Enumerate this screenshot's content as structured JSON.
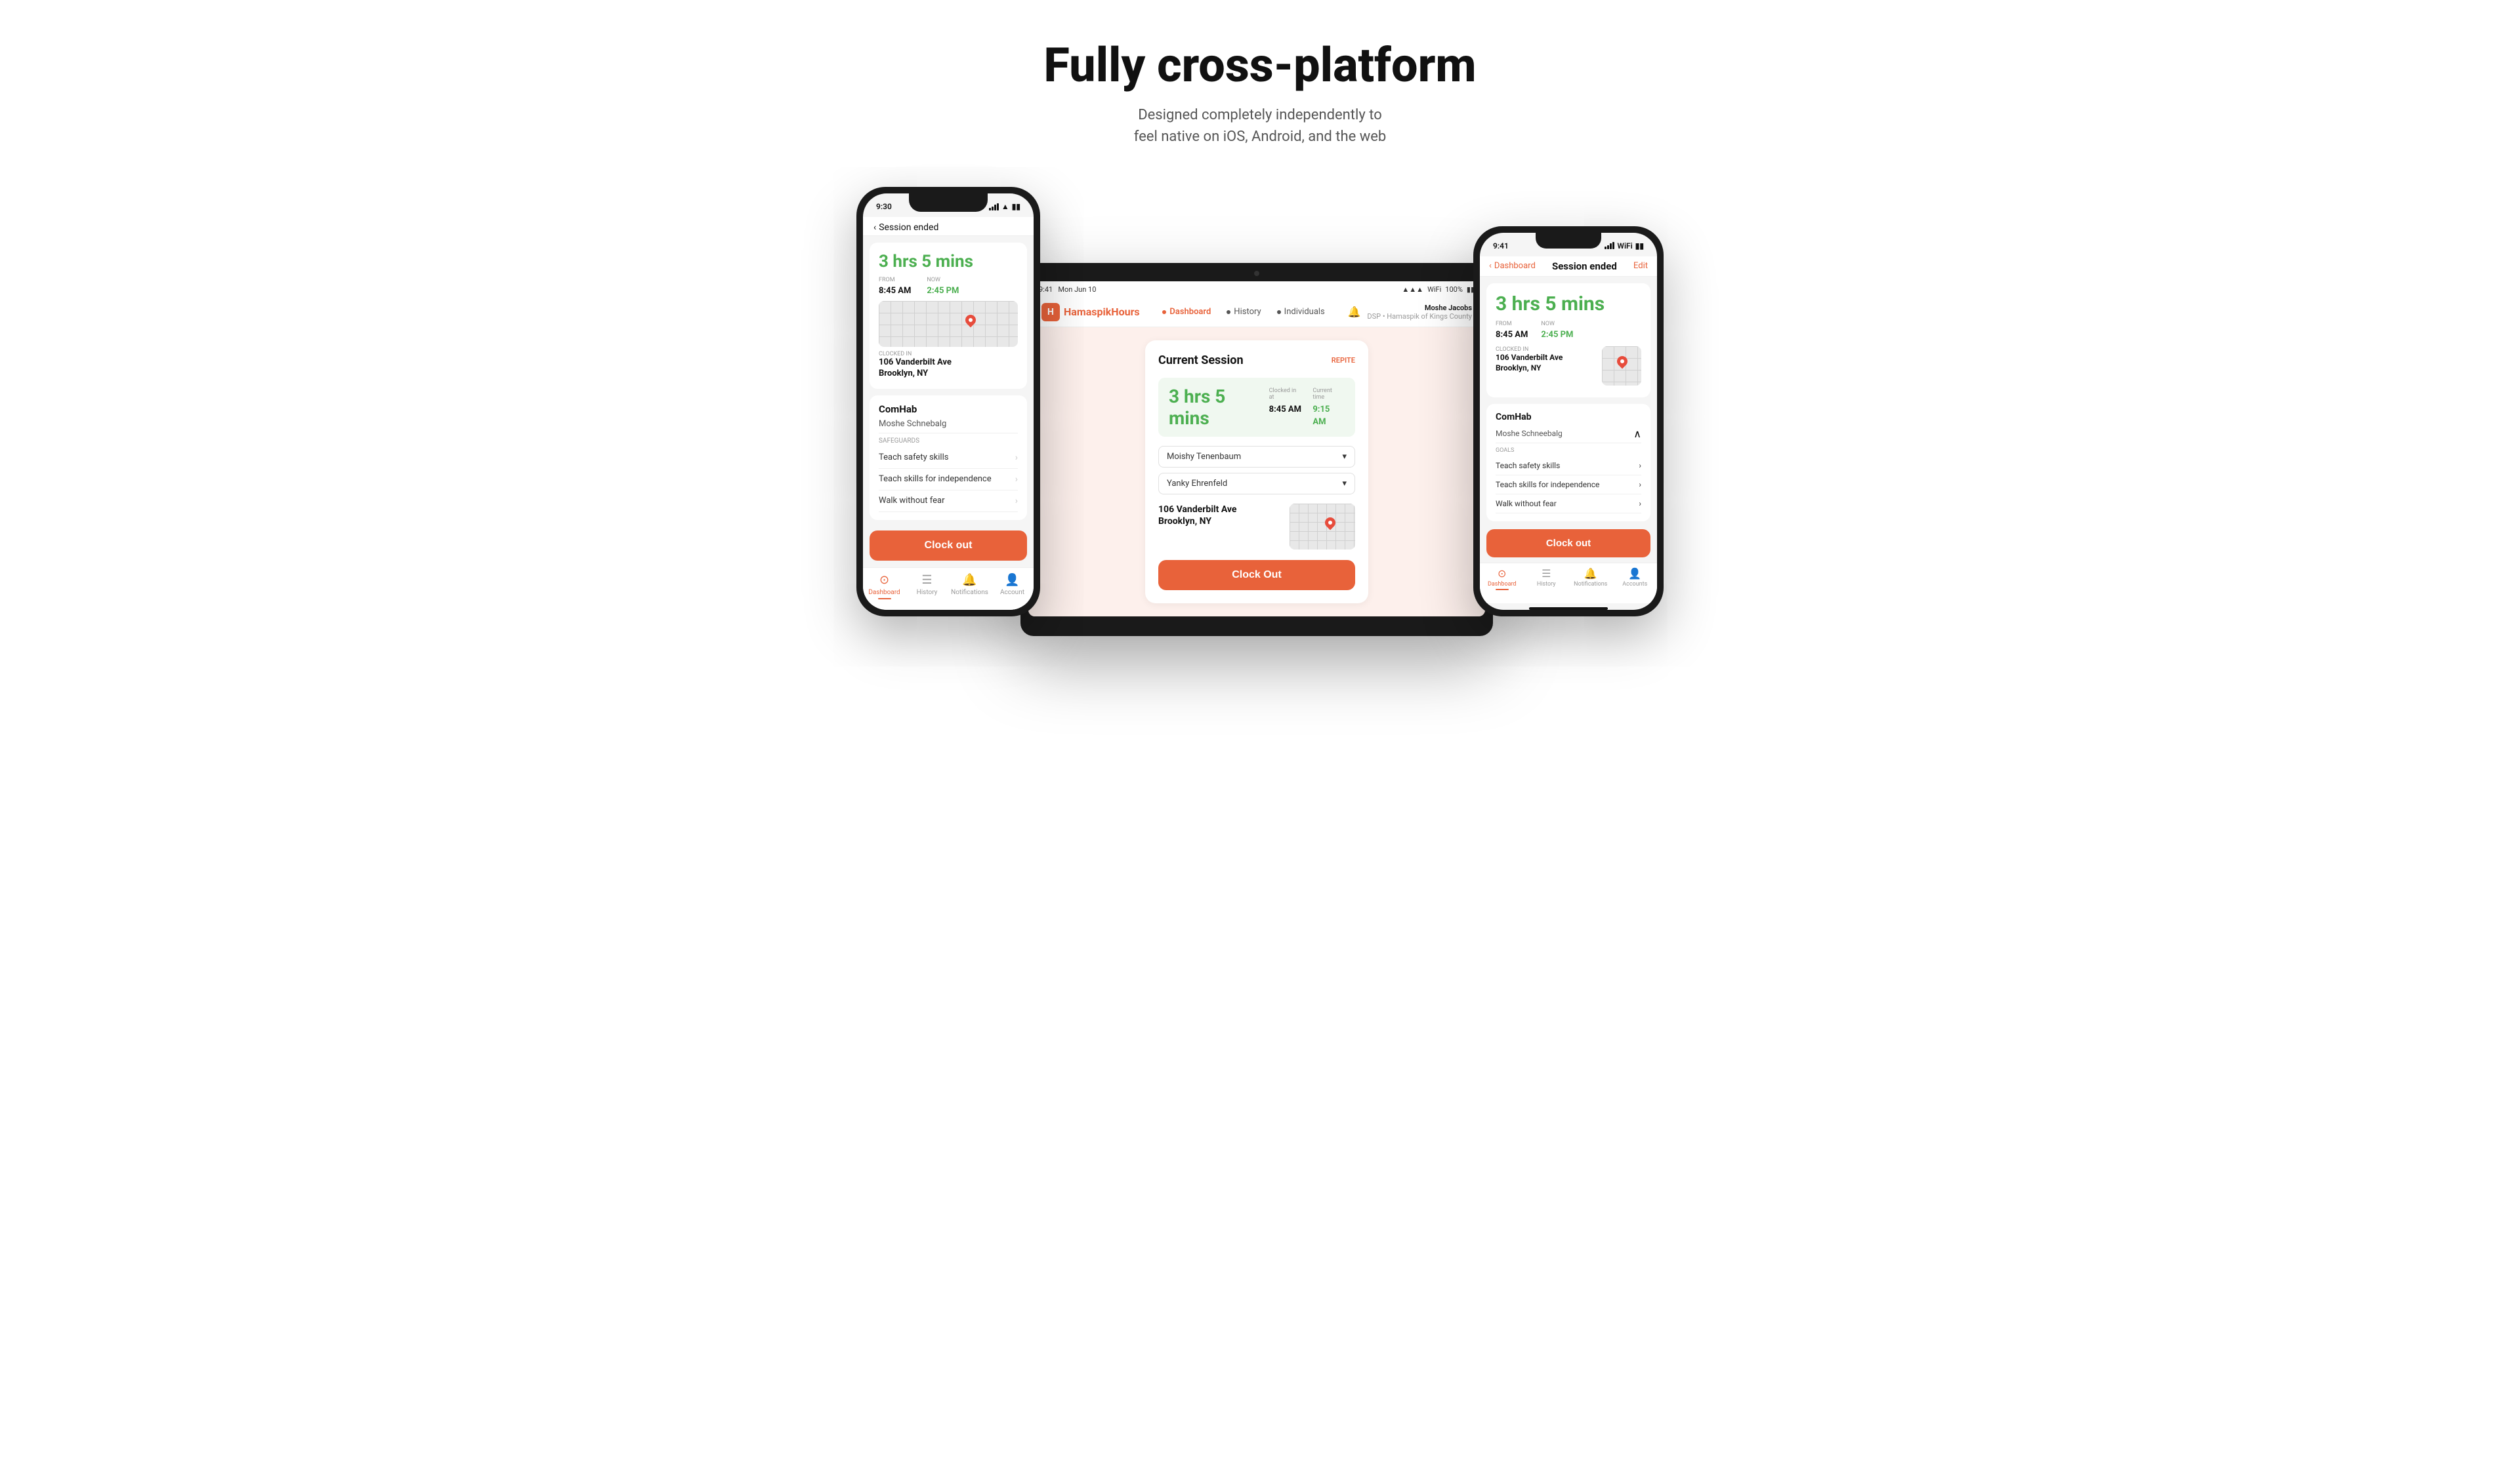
{
  "hero": {
    "title": "Fully cross-platform",
    "subtitle_line1": "Designed completely independently to",
    "subtitle_line2": "feel native on iOS, Android, and the web"
  },
  "left_phone": {
    "status_time": "9:30",
    "back_label": "Session ended",
    "session_duration": "3 hrs 5 mins",
    "from_label": "FROM",
    "now_label": "NOW",
    "from_time": "8:45 AM",
    "now_time": "2:45 PM",
    "clocked_in_label": "CLOCKED IN",
    "address_line1": "106 Vanderbilt Ave",
    "address_line2": "Brooklyn, NY",
    "service_name": "ComHab",
    "person_name": "Moshe Schnebalg",
    "safeguards_label": "Safeguards",
    "goals": [
      "Teach safety skills",
      "Teach skills for independence",
      "Walk without fear"
    ],
    "clock_out_label": "Clock out",
    "tabs": [
      {
        "label": "Dashboard",
        "active": true
      },
      {
        "label": "History",
        "active": false
      },
      {
        "label": "Notifications",
        "active": false
      },
      {
        "label": "Account",
        "active": false
      }
    ]
  },
  "tablet": {
    "status_time": "9:41",
    "status_date": "Mon Jun 10",
    "logo_text1": "Hamaspik",
    "logo_text2": "Hours",
    "nav_links": [
      {
        "label": "Dashboard",
        "active": true
      },
      {
        "label": "History",
        "active": false
      },
      {
        "label": "Individuals",
        "active": false
      }
    ],
    "user_name": "Moshe Jacobs",
    "user_org": "DSP • Hamaspik of Kings County",
    "current_session_title": "Current Session",
    "repite_label": "REPITE",
    "session_duration": "3 hrs 5 mins",
    "clocked_in_at_label": "Clocked in at",
    "clocked_in_time": "8:45 AM",
    "current_time_label": "Current time",
    "current_time": "9:15 AM",
    "worker1": "Moishy Tenenbaum",
    "worker2": "Yanky Ehrenfeld",
    "address_line1": "106 Vanderbilt Ave",
    "address_line2": "Brooklyn, NY",
    "clock_out_label": "Clock Out"
  },
  "right_phone": {
    "status_time": "9:41",
    "back_label": "Dashboard",
    "nav_title": "Session ended",
    "edit_label": "Edit",
    "session_duration": "3 hrs 5 mins",
    "from_label": "FROM",
    "now_label": "NOW",
    "from_time": "8:45 AM",
    "now_time": "2:45 PM",
    "clocked_in_label": "CLOCKED IN",
    "address_line1": "106 Vanderbilt Ave",
    "address_line2": "Brooklyn, NY",
    "service_name": "ComHab",
    "person_name": "Moshe Schneebalg",
    "goals_label": "Goals",
    "goals": [
      "Teach safety skills",
      "Teach skills for independence",
      "Walk without fear"
    ],
    "clock_out_label": "Clock out",
    "tabs": [
      {
        "label": "Dashboard",
        "active": true
      },
      {
        "label": "History",
        "active": false
      },
      {
        "label": "Notifications",
        "active": false
      },
      {
        "label": "Accounts",
        "active": false
      }
    ]
  }
}
